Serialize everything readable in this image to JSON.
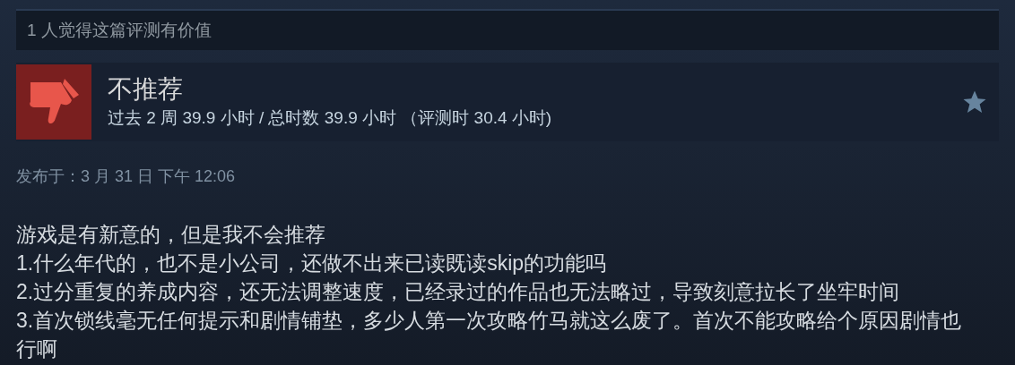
{
  "helpful_bar": {
    "text": "1 人觉得这篇评测有价值"
  },
  "review_header": {
    "verdict": "不推荐",
    "recommended": false,
    "hours": "过去 2 周 39.9 小时 / 总时数 39.9 小时 （评测时 30.4 小时)"
  },
  "posted_date": "发布于：3 月 31 日 下午 12:06",
  "body": [
    "游戏是有新意的，但是我不会推荐",
    "1.什么年代的，也不是小公司，还做不出来已读既读skip的功能吗",
    "2.过分重复的养成内容，还无法调整速度，已经录过的作品也无法略过，导致刻意拉长了坐牢时间",
    "3.首次锁线毫无任何提示和剧情铺垫，多少人第一次攻略竹马就这么废了。首次不能攻略给个原因剧情也行啊"
  ]
}
